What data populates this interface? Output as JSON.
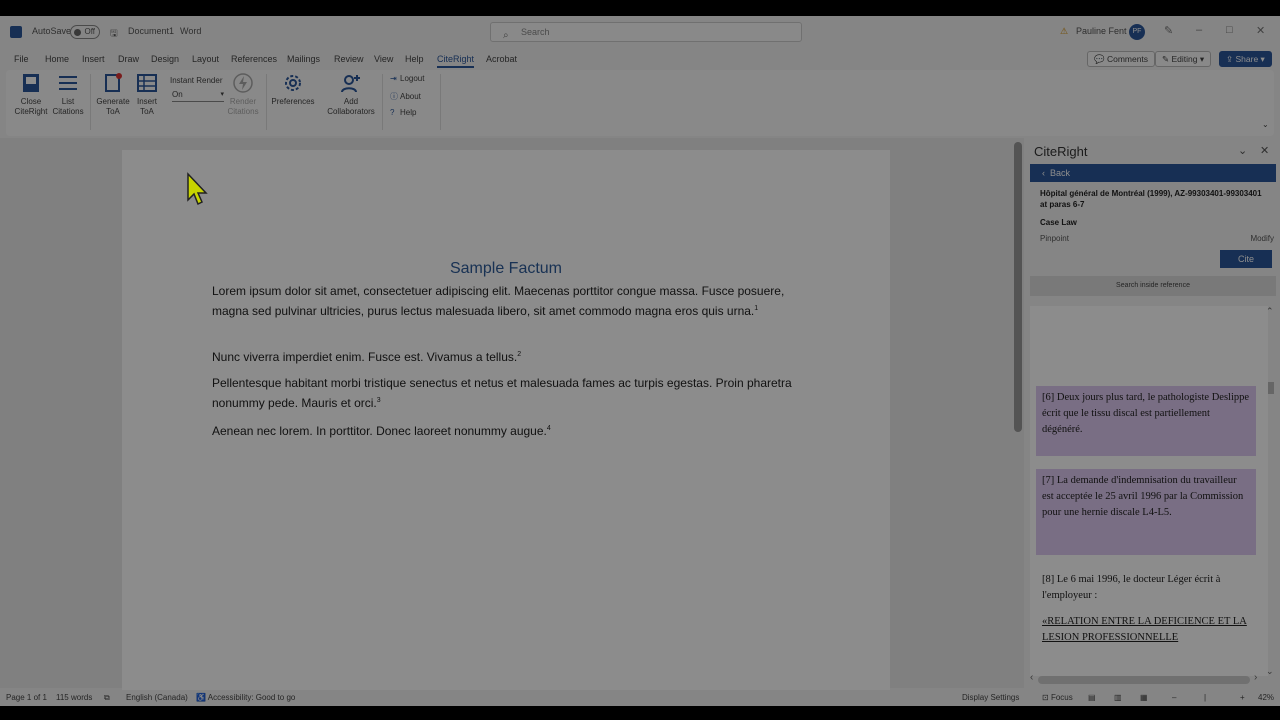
{
  "titlebar": {
    "autosave_label": "AutoSave",
    "autosave_state": "Off",
    "doc_name": "Document1",
    "app_name": "Word",
    "search_placeholder": "Search",
    "user_name": "Pauline Fent",
    "user_initials": "PF"
  },
  "tabs": [
    "File",
    "Home",
    "Insert",
    "Draw",
    "Design",
    "Layout",
    "References",
    "Mailings",
    "Review",
    "View",
    "Help",
    "CiteRight",
    "Acrobat"
  ],
  "active_tab": "CiteRight",
  "tab_buttons": {
    "comments": "Comments",
    "editing": "Editing",
    "share": "Share"
  },
  "ribbon": {
    "close": "Close CiteRight",
    "list": "List Citations",
    "generate": "Generate ToA",
    "insert": "Insert ToA",
    "instant_render_label": "Instant Render",
    "instant_render_value": "On",
    "render": "Render Citations",
    "preferences": "Preferences",
    "add_collab": "Add Collaborators",
    "logout": "Logout",
    "about": "About",
    "help": "Help"
  },
  "document": {
    "title": "Sample Factum",
    "paragraphs": [
      {
        "text": "Lorem ipsum dolor sit amet, consectetuer adipiscing elit. Maecenas porttitor congue massa. Fusce posuere, magna sed pulvinar ultricies, purus lectus malesuada libero, sit amet commodo magna eros quis urna.",
        "fn": "1"
      },
      {
        "text": "Nunc viverra imperdiet enim. Fusce est. Vivamus a tellus.",
        "fn": "2"
      },
      {
        "text": "Pellentesque habitant morbi tristique senectus et netus et malesuada fames ac turpis egestas. Proin pharetra nonummy pede. Mauris et orci.",
        "fn": "3"
      },
      {
        "text": "Aenean nec lorem. In porttitor. Donec laoreet nonummy augue.",
        "fn": "4"
      }
    ]
  },
  "pane": {
    "title": "CiteRight",
    "back": "Back",
    "ref_title": "Hôpital général de Montréal (1999), AZ-99303401-99303401 at paras 6-7",
    "ref_type": "Case Law",
    "pinpoint": "Pinpoint",
    "modify": "Modify",
    "cite": "Cite",
    "search_inside": "Search inside reference",
    "blocks": [
      {
        "text": "[6]        Deux jours plus tard, le pathologiste Deslippe écrit que le tissu discal est partiellement dégénéré."
      },
      {
        "text": "[7]        La demande d'indemnisation du travailleur est acceptée le 25 avril 1996 par la Commission pour une hernie discale L4-L5."
      },
      {
        "text": "[8]        Le 6 mai 1996, le docteur Léger écrit à l'employeur :"
      },
      {
        "text": "«RELATION ENTRE LA DEFICIENCE ET LA LESION PROFESSIONNELLE"
      }
    ]
  },
  "statusbar": {
    "page": "Page 1 of 1",
    "words": "115 words",
    "language": "English (Canada)",
    "accessibility": "Accessibility: Good to go",
    "display_settings": "Display Settings",
    "focus": "Focus",
    "zoom": "42%"
  },
  "colors": {
    "accent": "#2b579a",
    "highlight": "#dcc8f0",
    "title_blue": "#2e5c99"
  }
}
